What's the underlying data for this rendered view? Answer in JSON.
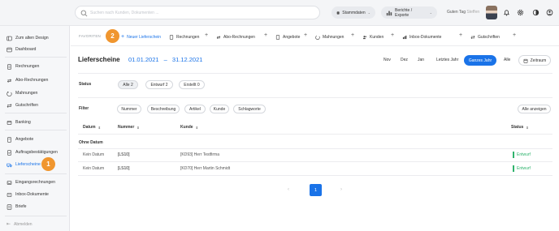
{
  "search": {
    "placeholder": "Suchen nach Kunden, Dokumenten ..."
  },
  "topbar": {
    "stammdaten": "Stammdaten",
    "berichte": "Berichte / Exporte",
    "greeting": "Guten Tag",
    "user": "Steffen"
  },
  "sidebar": {
    "items": [
      {
        "label": "Zum alten Design",
        "icon": "back-icon"
      },
      {
        "label": "Dashboard",
        "icon": "dashboard-icon"
      },
      {
        "label": "Rechnungen",
        "icon": "document-icon"
      },
      {
        "label": "Abo-Rechnungen",
        "icon": "repeat-icon"
      },
      {
        "label": "Mahnungen",
        "icon": "reminder-icon"
      },
      {
        "label": "Gutschriften",
        "icon": "swap-icon"
      },
      {
        "label": "Banking",
        "icon": "bank-icon"
      },
      {
        "label": "Angebote",
        "icon": "quote-icon"
      },
      {
        "label": "Auftragsbestätigungen",
        "icon": "order-icon"
      },
      {
        "label": "Lieferscheine",
        "icon": "truck-icon"
      },
      {
        "label": "Eingangsrechnungen",
        "icon": "inbox-icon"
      },
      {
        "label": "Inbox-Dokumente",
        "icon": "inbox-docs-icon"
      },
      {
        "label": "Briefe",
        "icon": "letter-icon"
      }
    ],
    "logout": "Abmelden",
    "badge": "1"
  },
  "favorites": {
    "label": "FAVORITEN",
    "badge": "2",
    "items": [
      {
        "label": "Neuer Lieferschein"
      },
      {
        "label": "Rechnungen"
      },
      {
        "label": "Abo-Rechnungen"
      },
      {
        "label": "Angebote"
      },
      {
        "label": "Mahnungen"
      },
      {
        "label": "Kunden"
      },
      {
        "label": "Inbox-Dokumente"
      },
      {
        "label": "Gutschriften"
      }
    ]
  },
  "page": {
    "title": "Lieferscheine",
    "date_from": "01.01.2021",
    "date_sep": "–",
    "date_to": "31.12.2021",
    "periods": [
      "Nov",
      "Dez",
      "Jan",
      "Letztes Jahr"
    ],
    "period_active": "Ganzes Jahr",
    "period_all": "Alle",
    "zeitraum": "Zeitraum"
  },
  "status": {
    "label": "Status",
    "pills": [
      "Alle 2",
      "Entwurf 2",
      "Erstellt 0"
    ]
  },
  "filter": {
    "label": "Filter",
    "pills": [
      "Nummer",
      "Beschreibung",
      "Artikel",
      "Kunde",
      "Schlagworte"
    ],
    "show_all": "Alle anzeigen"
  },
  "table": {
    "headers": {
      "datum": "Datum",
      "nummer": "Nummer",
      "kunde": "Kunde",
      "status": "Status"
    },
    "group": "Ohne Datum",
    "rows": [
      {
        "datum": "Kein Datum",
        "nummer": "[LS10]",
        "kunde": "[KD93] Herr Testfirma",
        "status": "Entwurf"
      },
      {
        "datum": "Kein Datum",
        "nummer": "[LS10]",
        "kunde": "[KD70] Herr Martin Schmidt",
        "status": "Entwurf"
      }
    ]
  },
  "pager": {
    "current": "1",
    "prev": "‹",
    "next": "›"
  },
  "colors": {
    "accent": "#1a73e8",
    "badge": "#f0962f",
    "status_draft": "#2fb36d"
  }
}
